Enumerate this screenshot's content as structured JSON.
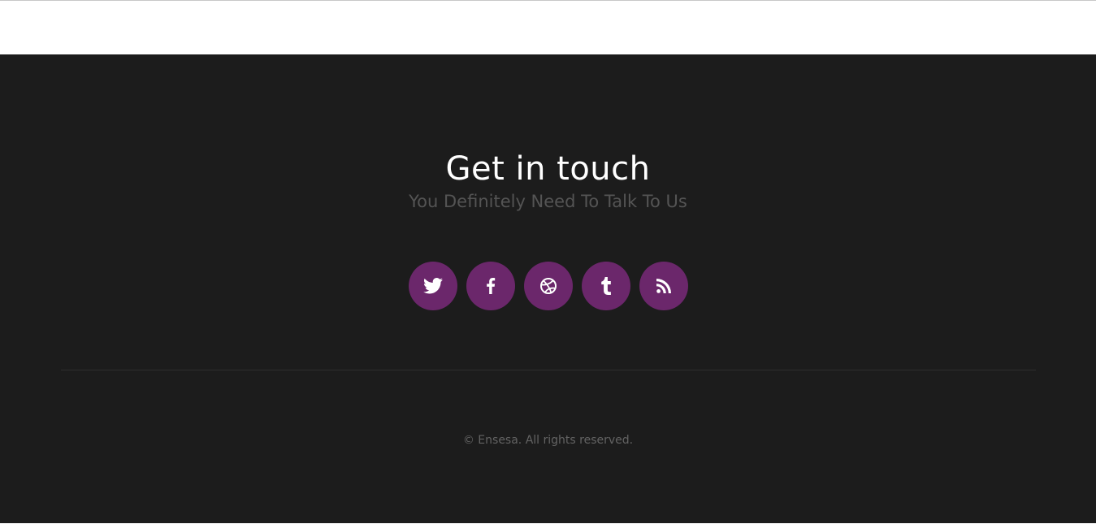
{
  "colors": {
    "footer_background": "#1c1c1c",
    "accent": "#6b276b",
    "title": "#ffffff",
    "subtitle": "#545454",
    "copyright": "#636363"
  },
  "contact": {
    "title": "Get in touch",
    "subtitle": "You Definitely Need To Talk To Us"
  },
  "social_links": [
    {
      "icon": "twitter-icon"
    },
    {
      "icon": "facebook-icon"
    },
    {
      "icon": "dribbble-icon"
    },
    {
      "icon": "tumblr-icon"
    },
    {
      "icon": "rss-icon"
    }
  ],
  "footer": {
    "copyright": "© Ensesa. All rights reserved."
  }
}
